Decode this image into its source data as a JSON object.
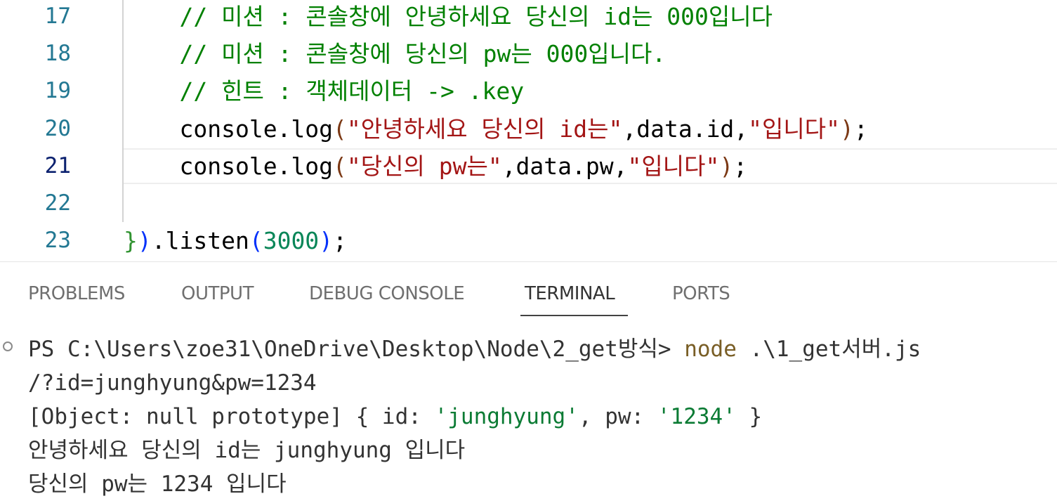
{
  "editor": {
    "line_numbers": [
      "17",
      "18",
      "19",
      "20",
      "21",
      "22",
      "23"
    ],
    "lines": [
      {
        "indent": "    ",
        "comment": "// 미션 : 콘솔창에 안녕하세요 당신의 id는 000입니다"
      },
      {
        "indent": "    ",
        "comment": "// 미션 : 콘솔창에 당신의 pw는 000입니다."
      },
      {
        "indent": "    ",
        "comment": "// 힌트 : 객체데이터 -> .key"
      },
      {
        "indent": "    ",
        "fn": "console.log",
        "open": "(",
        "s1": "\"안녕하세요 당신의 id는\"",
        "c1": ",data.id,",
        "s2": "\"입니다\"",
        "close": ")",
        "end": ";"
      },
      {
        "indent": "    ",
        "fn": "console.log",
        "open": "(",
        "s1": "\"당신의 pw는\"",
        "c1": ",data.pw,",
        "s2": "\"입니다\"",
        "close": ")",
        "end": ";"
      },
      {
        "text": ""
      },
      {
        "b1": "}",
        "b2": ")",
        "mid": ".listen",
        "open": "(",
        "num": "3000",
        "close": ")",
        "end": ";"
      }
    ]
  },
  "panel": {
    "tabs": [
      "PROBLEMS",
      "OUTPUT",
      "DEBUG CONSOLE",
      "TERMINAL",
      "PORTS"
    ],
    "active_tab": "TERMINAL"
  },
  "terminal": {
    "prompt": "PS C:\\Users\\zoe31\\OneDrive\\Desktop\\Node\\2_get방식> ",
    "command": "node",
    "args": " .\\1_get서버.js",
    "line2": "/?id=junghyung&pw=1234",
    "obj_prefix": "[Object: null prototype] { id: ",
    "obj_id": "'junghyung'",
    "obj_mid": ", pw: ",
    "obj_pw": "'1234'",
    "obj_suffix": " }",
    "out1": "안녕하세요 당신의 id는 junghyung 입니다",
    "out2": "당신의 pw는 1234 입니다"
  }
}
